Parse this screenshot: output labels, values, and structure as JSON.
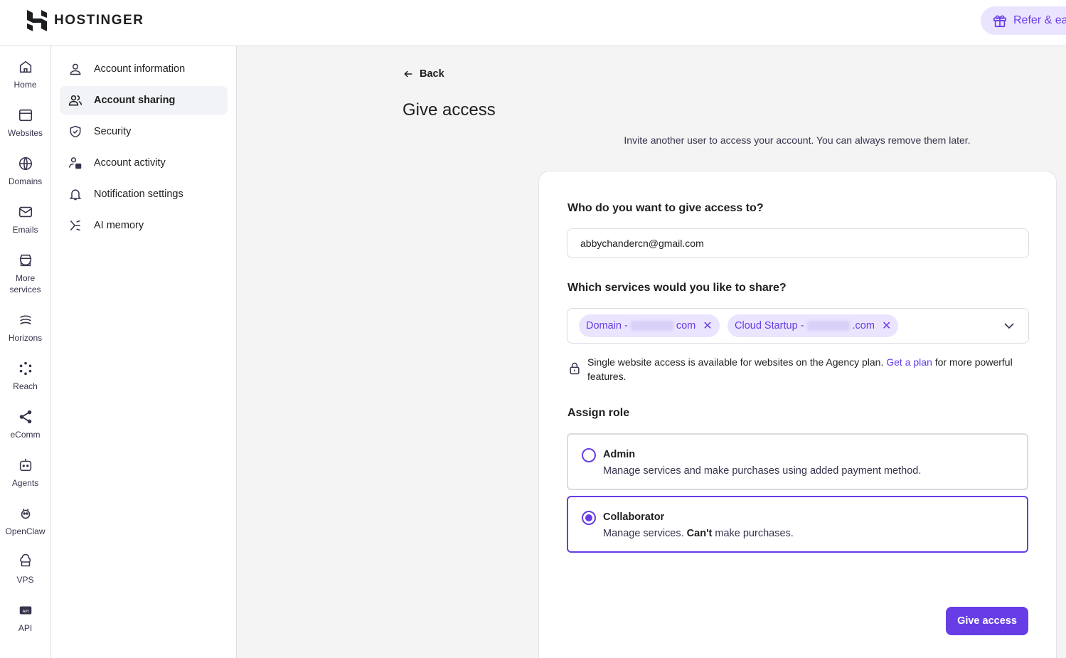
{
  "brand": {
    "name": "HOSTINGER",
    "accent": "#673de6"
  },
  "header": {
    "refer_label": "Refer & ea"
  },
  "rail": [
    {
      "label": "Home",
      "icon": "home-icon"
    },
    {
      "label": "Websites",
      "icon": "browser-icon"
    },
    {
      "label": "Domains",
      "icon": "globe-icon"
    },
    {
      "label": "Emails",
      "icon": "mail-icon"
    },
    {
      "label": "More services",
      "icon": "store-icon"
    },
    {
      "label": "Horizons",
      "icon": "horizons-icon"
    },
    {
      "label": "Reach",
      "icon": "reach-icon"
    },
    {
      "label": "eComm",
      "icon": "share-icon"
    },
    {
      "label": "Agents",
      "icon": "agent-icon"
    },
    {
      "label": "OpenClaw",
      "icon": "openclaw-icon"
    },
    {
      "label": "VPS",
      "icon": "cloud-server-icon"
    },
    {
      "label": "API",
      "icon": "api-icon"
    }
  ],
  "subnav": [
    {
      "label": "Account information",
      "icon": "person-icon"
    },
    {
      "label": "Account sharing",
      "icon": "people-icon",
      "active": true
    },
    {
      "label": "Security",
      "icon": "shield-icon"
    },
    {
      "label": "Account activity",
      "icon": "activity-icon"
    },
    {
      "label": "Notification settings",
      "icon": "bell-icon"
    },
    {
      "label": "AI memory",
      "icon": "ai-icon"
    }
  ],
  "page": {
    "back_label": "Back",
    "title": "Give access",
    "subtitle": "Invite another user to access your account. You can always remove them later."
  },
  "form": {
    "email_label": "Who do you want to give access to?",
    "email_value": "abbychandercn@gmail.com",
    "services_label": "Which services would you like to share?",
    "chips": [
      {
        "prefix": "Domain -",
        "suffix": "com"
      },
      {
        "prefix": "Cloud Startup -",
        "suffix": ".com"
      }
    ],
    "note_text": "Single website access is available for websites on the Agency plan.",
    "note_link": "Get a plan",
    "note_tail": "for more powerful features.",
    "role_label": "Assign role",
    "roles": [
      {
        "title": "Admin",
        "desc": "Manage services and make purchases using added payment method.",
        "selected": false
      },
      {
        "title": "Collaborator",
        "desc_a": "Manage services.",
        "desc_b": "Can't",
        "desc_c": "make purchases.",
        "selected": true
      }
    ],
    "submit_label": "Give access"
  }
}
